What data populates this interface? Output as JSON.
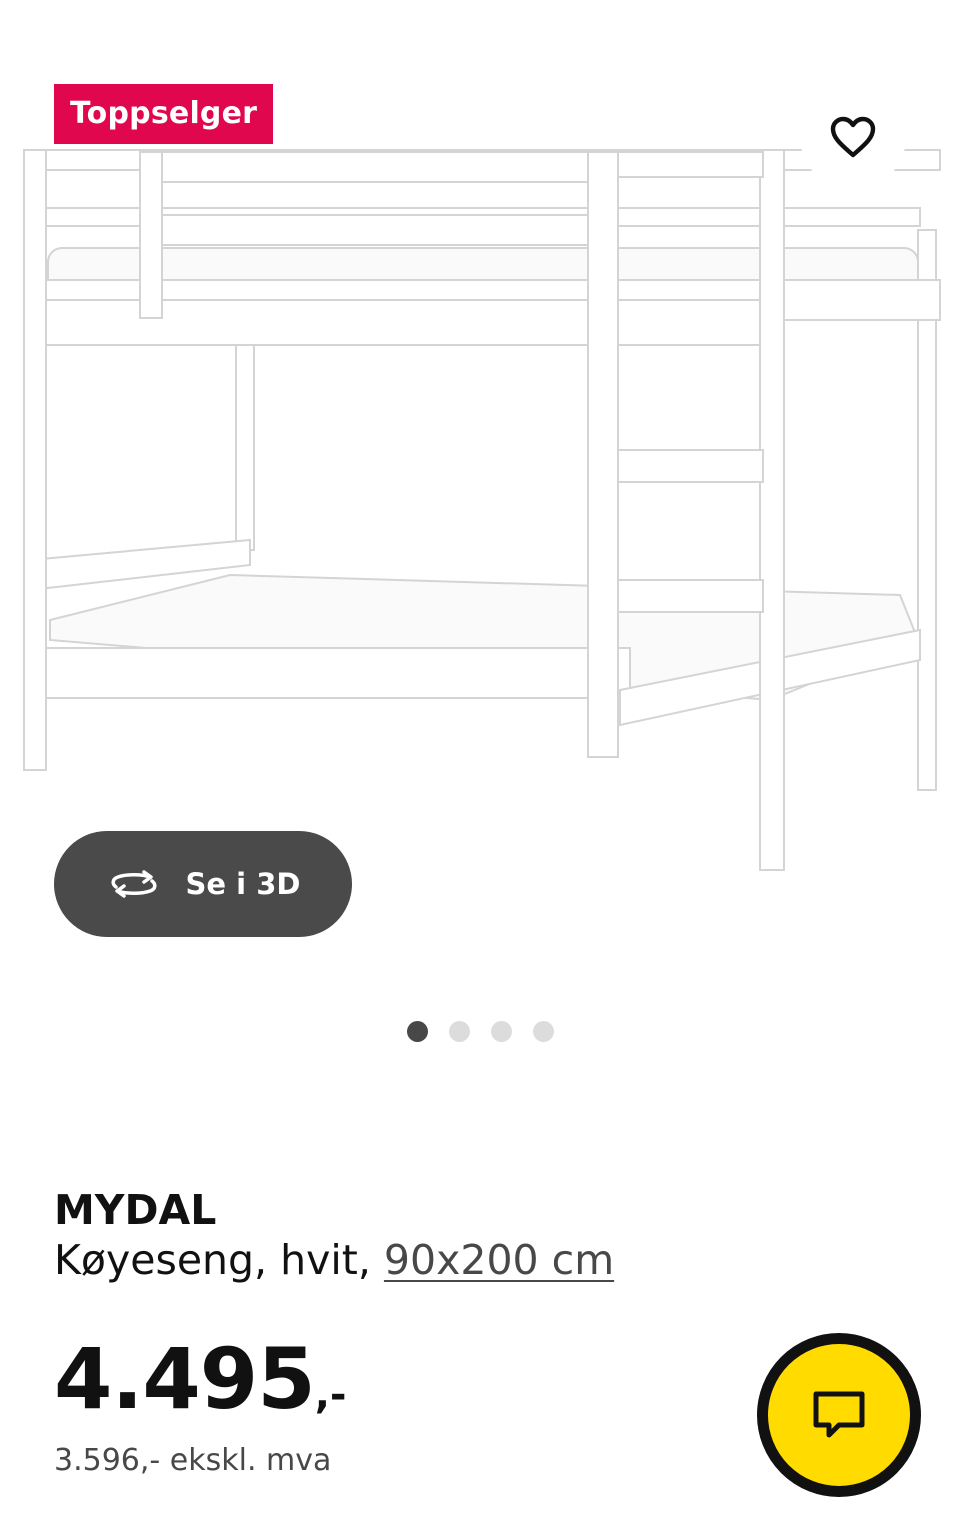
{
  "gallery": {
    "badge": "Toppselger",
    "view3d_label": "Se i 3D",
    "dot_count": 4,
    "active_dot": 1
  },
  "product": {
    "name": "MYDAL",
    "description": "Køyeseng, hvit,",
    "size_link": "90x200 cm",
    "price_main": "4.495",
    "price_suffix": ",-",
    "price_ex_vat": "3.596,- ekskl. mva"
  },
  "icons": {
    "favorite": "heart-icon",
    "view3d": "rotate-3d-icon",
    "chat": "chat-icon"
  },
  "colors": {
    "badge_bg": "#e0074f",
    "view3d_bg": "#4a4a4a",
    "chat_bg": "#ffdb00",
    "dot_active": "#484848",
    "dot_inactive": "#dcdcdc"
  }
}
